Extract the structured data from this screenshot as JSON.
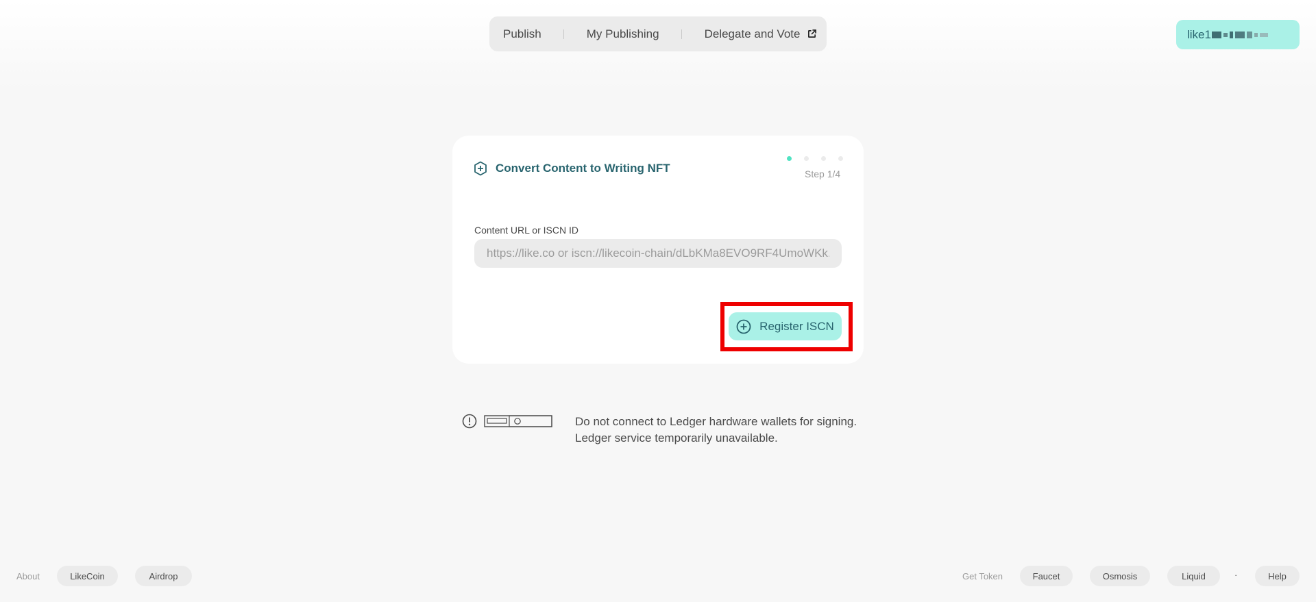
{
  "nav": {
    "items": [
      {
        "label": "Publish"
      },
      {
        "label": "My Publishing"
      },
      {
        "label": "Delegate and Vote",
        "icon": "external-link-icon"
      }
    ]
  },
  "wallet": {
    "address_prefix": "like1"
  },
  "card": {
    "title": "Convert Content to Writing NFT",
    "title_icon": "add-circle-icon",
    "step_label": "Step 1/4",
    "steps_total": 4,
    "current_step": 1,
    "field_label": "Content URL or ISCN ID",
    "input_placeholder": "https://like.co or iscn://likecoin-chain/dLbKMa8EVO9RF4UmoWKk...",
    "input_value": "",
    "register_button": "Register ISCN",
    "register_icon": "add-circle-icon"
  },
  "notice": {
    "line1": "Do not connect to Ledger hardware wallets for signing.",
    "line2": "Ledger service temporarily unavailable.",
    "icons": [
      "warning-icon",
      "ledger-device-icon"
    ]
  },
  "footer": {
    "about_label": "About",
    "about_links": [
      "LikeCoin",
      "Airdrop"
    ],
    "get_token_label": "Get Token",
    "token_links": [
      "Faucet",
      "Osmosis",
      "Liquid"
    ],
    "separator": "·",
    "help": "Help"
  },
  "colors": {
    "accent": "#aaf1e7",
    "brand_dark": "#28646e",
    "active_dot": "#50e3c2",
    "highlight": "#ee0000",
    "background": "#f7f7f7"
  }
}
